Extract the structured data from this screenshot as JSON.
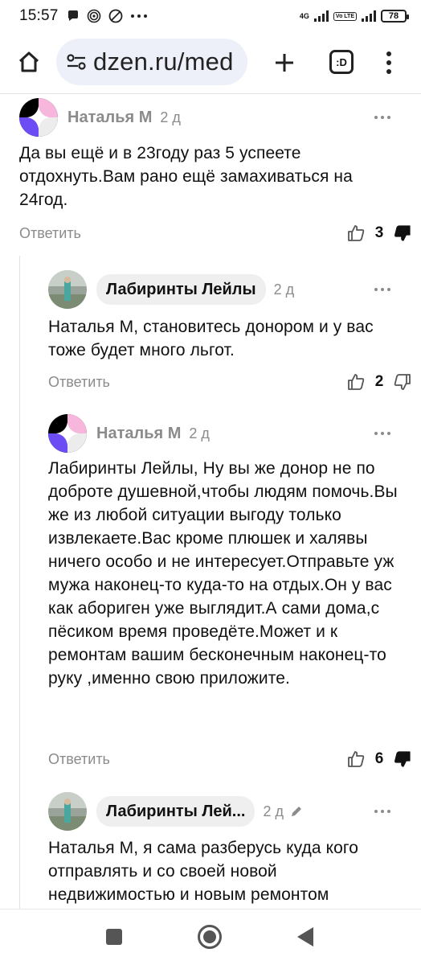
{
  "status_bar": {
    "time": "15:57",
    "network": "4G",
    "volte": "Vo LTE",
    "battery": "78"
  },
  "browser": {
    "url": "dzen.ru/med",
    "tabs_label": ":D"
  },
  "comments": [
    {
      "author": "Наталья М",
      "date": "2 д",
      "text": "Да вы ещё и в 23году раз 5 успеете отдохнуть.Вам рано ещё замахиваться на 24год.",
      "reply_label": "Ответить",
      "likes": "3"
    },
    {
      "author": "Лабиринты Лейлы",
      "date": "2 д",
      "text": "Наталья М, становитесь донором и у вас тоже будет много льгот.",
      "reply_label": "Ответить",
      "likes": "2"
    },
    {
      "author": "Наталья М",
      "date": "2 д",
      "text": "Лабиринты Лейлы, Ну вы же донор не по доброте душевной,чтобы людям помочь.Вы же из любой ситуации выгоду только извлекаете.Вас кроме плюшек и халявы ничего особо и не интересует.Отправьте уж мужа наконец-то куда-то на отдых.Он у вас как абориген уже выглядит.А сами дома,с пёсиком время проведёте.Может и к ремонтам вашим бесконечным наконец-то руку ,именно свою приложите.",
      "reply_label": "Ответить",
      "likes": "6"
    },
    {
      "author": "Лабиринты Лей...",
      "date": "2 д",
      "text": "Наталья М, я сама разберусь куда кого отправлять и со своей новой недвижимостью и новым ремонтом"
    }
  ]
}
